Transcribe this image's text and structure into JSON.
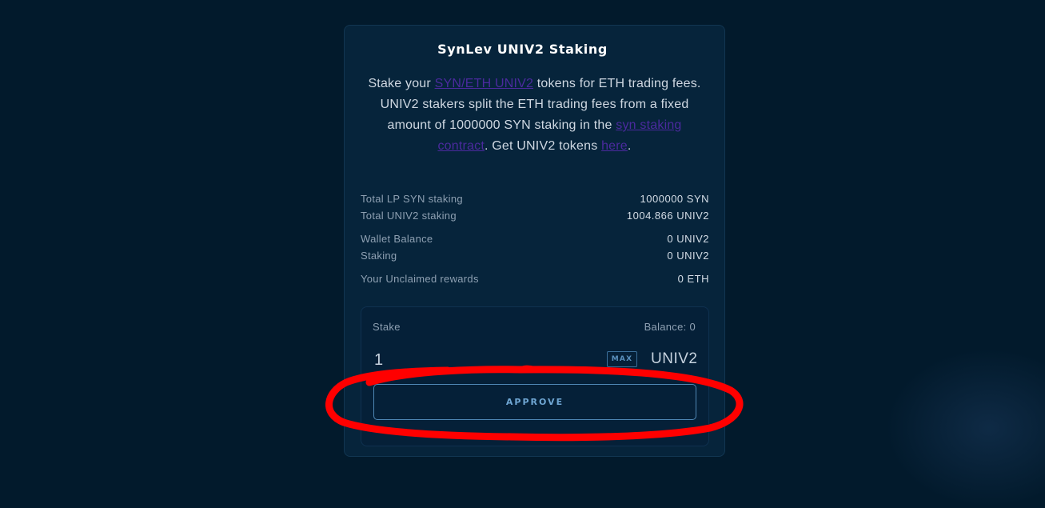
{
  "card": {
    "title": "SynLev UNIV2 Staking",
    "description": {
      "part1": "Stake your ",
      "link1": "SYN/ETH UNIV2",
      "part2": " tokens for ETH trading fees. UNIV2 stakers split the ETH trading fees from a fixed amount of 1000000 SYN staking in the ",
      "link2": "syn staking contract",
      "part3": ". Get UNIV2 tokens ",
      "link3": "here",
      "part4": "."
    },
    "stats": [
      {
        "label": "Total LP SYN staking",
        "value": "1000000 SYN"
      },
      {
        "label": "Total UNIV2 staking",
        "value": "1004.866 UNIV2"
      },
      {
        "label": "Wallet Balance",
        "value": "0 UNIV2"
      },
      {
        "label": "Staking",
        "value": "0 UNIV2"
      },
      {
        "label": "Your Unclaimed rewards",
        "value": "0 ETH"
      }
    ]
  },
  "stake": {
    "label": "Stake",
    "balance": "Balance: 0",
    "amount": "1",
    "max_label": "MAX",
    "unit": "UNIV2",
    "approve_label": "APPROVE"
  },
  "colors": {
    "background": "#021a2c",
    "card": "#06243b",
    "link": "#4b2a9e",
    "accent": "#6fa6d3",
    "annotation": "#ff0000"
  }
}
